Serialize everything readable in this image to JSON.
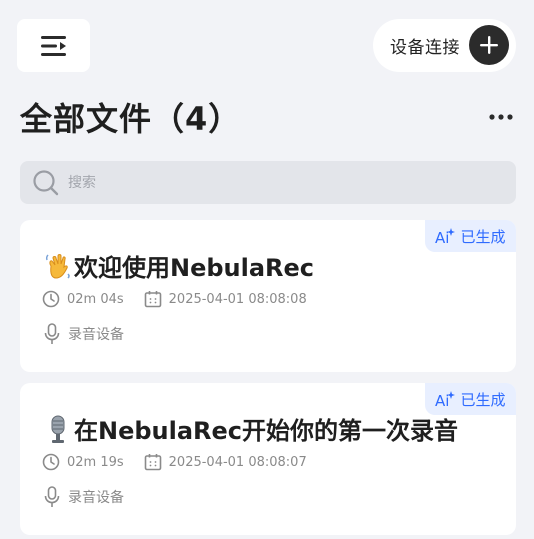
{
  "header": {
    "menu_icon": "menu-collapse-icon",
    "connect_label": "设备连接",
    "add_icon": "plus-icon"
  },
  "title": "全部文件（4）",
  "more_icon": "more-horizontal-icon",
  "search": {
    "placeholder": "搜索",
    "icon": "search-icon"
  },
  "files": [
    {
      "emoji": "waving-hand",
      "title": "欢迎使用NebulaRec",
      "duration": "02m 04s",
      "datetime": "2025-04-01 08:08:08",
      "device": "录音设备",
      "badge": "已生成"
    },
    {
      "emoji": "microphone",
      "title": "在NebulaRec开始你的第一次录音",
      "duration": "02m 19s",
      "datetime": "2025-04-01 08:08:07",
      "device": "录音设备",
      "badge": "已生成"
    }
  ],
  "colors": {
    "accent": "#2f6bff",
    "background": "#f2f3f7",
    "badge_bg": "#e8efff"
  }
}
